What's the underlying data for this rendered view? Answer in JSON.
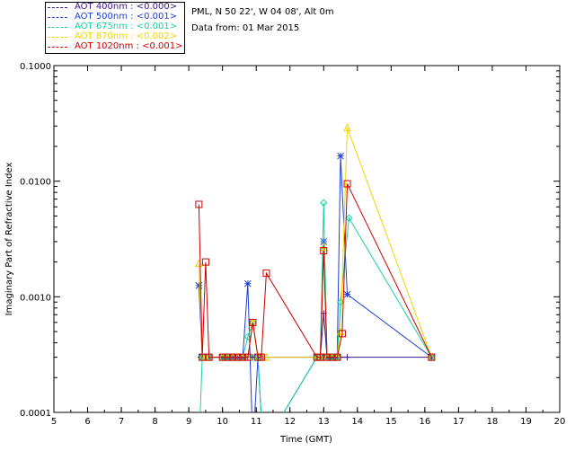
{
  "header": {
    "location": "PML, N 50 22', W 04 08', Alt 0m",
    "date": "Data from: 01 Mar 2015"
  },
  "legend": [
    {
      "label": "AOT  400nm : <0.000>",
      "color": "#3a1a8a"
    },
    {
      "label": "AOT  500nm : <0.001>",
      "color": "#1d3fd6"
    },
    {
      "label": "AOT  675nm : <0.001>",
      "color": "#19d2a0"
    },
    {
      "label": "AOT  870nm : <0.002>",
      "color": "#f0d400"
    },
    {
      "label": "AOT 1020nm : <0.001>",
      "color": "#cc0000"
    }
  ],
  "chart_data": {
    "type": "line",
    "title": "",
    "xlabel": "Time (GMT)",
    "ylabel": "Imaginary Part of Refractive Index",
    "xlim": [
      5,
      20
    ],
    "ylim": [
      0.0001,
      0.1
    ],
    "yscale": "log",
    "xticks": [
      5,
      6,
      7,
      8,
      9,
      10,
      11,
      12,
      13,
      14,
      15,
      16,
      17,
      18,
      19,
      20
    ],
    "xtick_labels": [
      "5",
      "6",
      "7",
      "8",
      "9",
      "10",
      "11",
      "12",
      "13",
      "14",
      "15",
      "16",
      "17",
      "18",
      "19",
      "20"
    ],
    "yticks": [
      0.0001,
      0.001,
      0.01,
      0.1
    ],
    "ytick_labels": [
      "0.0001",
      "0.0010",
      "0.0100",
      "0.1000"
    ],
    "grid": false,
    "legend_position": "top-left-outside",
    "series": [
      {
        "name": "AOT  400nm : <0.000>",
        "color": "#3a1a8a",
        "marker": "plus",
        "x": [
          9.35,
          9.5,
          9.6,
          10.0,
          10.15,
          10.3,
          10.45,
          10.6,
          10.75,
          10.9,
          11.05,
          11.2,
          12.8,
          12.9,
          13.0,
          13.1,
          13.25,
          13.35,
          13.5,
          13.7,
          16.2
        ],
        "y": [
          0.0003,
          0.0003,
          0.0003,
          0.0003,
          0.0003,
          0.0003,
          0.0003,
          0.0003,
          0.0003,
          0.0003,
          0.0003,
          0.0003,
          0.0003,
          0.0003,
          0.00072,
          0.0003,
          0.0003,
          0.0003,
          0.0003,
          0.0003,
          0.0003
        ]
      },
      {
        "name": "AOT  500nm : <0.001>",
        "color": "#1d3fd6",
        "marker": "star",
        "x": [
          9.3,
          9.4,
          9.5,
          9.6,
          10.0,
          10.15,
          10.3,
          10.45,
          10.6,
          10.75,
          10.9,
          11.05,
          11.2,
          12.8,
          12.9,
          13.0,
          13.1,
          13.25,
          13.4,
          13.5,
          13.7,
          16.2
        ],
        "y": [
          0.00125,
          0.0003,
          0.0003,
          0.0003,
          0.0003,
          0.0003,
          0.0003,
          0.0003,
          0.0003,
          0.0013,
          5e-05,
          0.0003,
          5e-05,
          0.0003,
          0.0003,
          0.003,
          0.0003,
          0.0003,
          0.0003,
          0.0165,
          0.00105,
          0.0003
        ]
      },
      {
        "name": "AOT  675nm : <0.001>",
        "color": "#19d2a0",
        "marker": "diamond",
        "x": [
          9.3,
          9.4,
          9.5,
          9.6,
          10.0,
          10.15,
          10.3,
          10.45,
          10.6,
          10.75,
          10.9,
          11.05,
          11.2,
          12.8,
          12.9,
          13.0,
          13.1,
          13.25,
          13.4,
          13.5,
          13.75,
          16.2
        ],
        "y": [
          5e-05,
          0.0003,
          0.0003,
          0.0003,
          0.0003,
          0.0003,
          0.0003,
          0.0003,
          0.0003,
          0.00045,
          0.0006,
          0.0003,
          5e-05,
          0.0003,
          0.0003,
          0.0065,
          0.0003,
          0.0003,
          0.0003,
          0.0009,
          0.0048,
          0.0003
        ]
      },
      {
        "name": "AOT  870nm : <0.002>",
        "color": "#f0d400",
        "marker": "triangle",
        "x": [
          9.3,
          9.4,
          9.5,
          9.6,
          10.0,
          10.15,
          10.3,
          10.45,
          10.6,
          10.75,
          10.9,
          11.05,
          11.2,
          11.3,
          12.8,
          12.9,
          13.0,
          13.1,
          13.25,
          13.4,
          13.5,
          13.7,
          16.2
        ],
        "y": [
          0.00195,
          0.0003,
          0.0003,
          0.0003,
          0.0003,
          0.0003,
          0.0003,
          0.0003,
          0.0003,
          0.0003,
          0.0006,
          0.0003,
          0.0003,
          0.0003,
          0.0003,
          0.0003,
          0.0027,
          0.0003,
          0.0003,
          0.0003,
          0.0005,
          0.029,
          0.0003
        ]
      },
      {
        "name": "AOT 1020nm : <0.001>",
        "color": "#cc0000",
        "marker": "square",
        "x": [
          9.3,
          9.4,
          9.5,
          9.6,
          10.0,
          10.15,
          10.3,
          10.45,
          10.6,
          10.75,
          10.9,
          11.05,
          11.15,
          11.3,
          12.8,
          12.9,
          13.0,
          13.1,
          13.25,
          13.4,
          13.55,
          13.7,
          16.2
        ],
        "y": [
          0.0063,
          0.0003,
          0.002,
          0.0003,
          0.0003,
          0.0003,
          0.0003,
          0.0003,
          0.0003,
          0.0003,
          0.0006,
          0.0003,
          0.0003,
          0.0016,
          0.0003,
          0.0003,
          0.0025,
          0.0003,
          0.0003,
          0.0003,
          0.00048,
          0.0095,
          0.0003
        ]
      }
    ]
  }
}
